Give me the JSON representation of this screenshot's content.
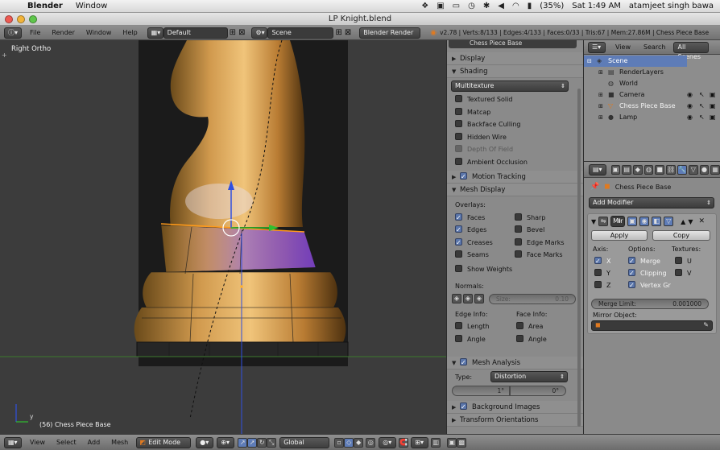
{
  "mac_menubar": {
    "app_name": "Blender",
    "menus": [
      "Window"
    ],
    "battery": "(35%)",
    "clock": "Sat 1:49 AM",
    "user": "atamjeet singh bawa"
  },
  "window": {
    "title": "LP Knight.blend"
  },
  "info_header": {
    "menus": [
      "File",
      "Render",
      "Window",
      "Help"
    ],
    "layout": "Default",
    "scene": "Scene",
    "engine": "Blender Render",
    "stats": "v2.78 | Verts:8/133 | Edges:4/133 | Faces:0/33 | Tris:67 | Mem:27.86M | Chess Piece Base"
  },
  "viewport": {
    "view_name": "Right Ortho",
    "object_label": "(56) Chess Piece Base",
    "axis_y_label": "y"
  },
  "properties_panel": {
    "top_object": "Chess Piece Base",
    "display_label": "Display",
    "shading_label": "Shading",
    "shading_mode": "Multitexture",
    "shading_options": [
      {
        "label": "Textured Solid",
        "checked": false,
        "disabled": false
      },
      {
        "label": "Matcap",
        "checked": false,
        "disabled": false
      },
      {
        "label": "Backface Culling",
        "checked": false,
        "disabled": false
      },
      {
        "label": "Hidden Wire",
        "checked": false,
        "disabled": false
      },
      {
        "label": "Depth Of Field",
        "checked": false,
        "disabled": true
      },
      {
        "label": "Ambient Occlusion",
        "checked": false,
        "disabled": false
      }
    ],
    "motion_tracking_label": "Motion Tracking",
    "mesh_display_label": "Mesh Display",
    "overlays_label": "Overlays:",
    "overlays_left": [
      {
        "label": "Faces",
        "checked": true
      },
      {
        "label": "Edges",
        "checked": true
      },
      {
        "label": "Creases",
        "checked": true
      },
      {
        "label": "Seams",
        "checked": false
      },
      {
        "label": "Show Weights",
        "checked": false
      }
    ],
    "overlays_right": [
      {
        "label": "Sharp",
        "checked": false
      },
      {
        "label": "Bevel",
        "checked": false
      },
      {
        "label": "Edge Marks",
        "checked": false
      },
      {
        "label": "Face Marks",
        "checked": false
      }
    ],
    "normals_label": "Normals:",
    "normals_size_label": "Size:",
    "normals_size_value": "0.10",
    "edge_info_label": "Edge Info:",
    "face_info_label": "Face Info:",
    "edge_info": [
      {
        "label": "Length",
        "checked": false
      },
      {
        "label": "Angle",
        "checked": false
      }
    ],
    "face_info": [
      {
        "label": "Area",
        "checked": false
      },
      {
        "label": "Angle",
        "checked": false
      }
    ],
    "mesh_analysis_label": "Mesh Analysis",
    "type_label": "Type:",
    "type_value": "Distortion",
    "range_min": "1°",
    "range_max": "0°",
    "background_images_label": "Background Images",
    "transform_orientations_label": "Transform Orientations"
  },
  "outliner": {
    "view_menu": "View",
    "search_menu": "Search",
    "filter": "All Scenes",
    "items": [
      {
        "label": "Scene",
        "selected": true
      },
      {
        "label": "RenderLayers",
        "selected": false
      },
      {
        "label": "World",
        "selected": false
      },
      {
        "label": "Camera",
        "selected": false
      },
      {
        "label": "Chess Piece Base",
        "selected": false
      },
      {
        "label": "Lamp",
        "selected": false
      }
    ]
  },
  "modifier_panel": {
    "object_name": "Chess Piece Base",
    "add_modifier": "Add Modifier",
    "modifier_name": "Mir",
    "apply_label": "Apply",
    "copy_label": "Copy",
    "axis_label": "Axis:",
    "options_label": "Options:",
    "textures_label": "Textures:",
    "axes": [
      {
        "label": "X",
        "checked": true
      },
      {
        "label": "Y",
        "checked": false
      },
      {
        "label": "Z",
        "checked": false
      }
    ],
    "options": [
      {
        "label": "Merge",
        "checked": true
      },
      {
        "label": "Clipping",
        "checked": true
      },
      {
        "label": "Vertex Gr",
        "checked": true
      }
    ],
    "textures": [
      {
        "label": "U",
        "checked": false
      },
      {
        "label": "V",
        "checked": false
      }
    ],
    "merge_limit_label": "Merge Limit:",
    "merge_limit_value": "0.001000",
    "mirror_object_label": "Mirror Object:"
  },
  "bottom_bar": {
    "menus": [
      "View",
      "Select",
      "Add",
      "Mesh"
    ],
    "mode": "Edit Mode",
    "orientation": "Global"
  },
  "colors": {
    "selection_blue": "#5e7cb7",
    "checkbox_on": "#5b76aa",
    "gizmo_red": "#d04040",
    "gizmo_green": "#2fbf2f",
    "gizmo_blue": "#2f4fe0"
  }
}
